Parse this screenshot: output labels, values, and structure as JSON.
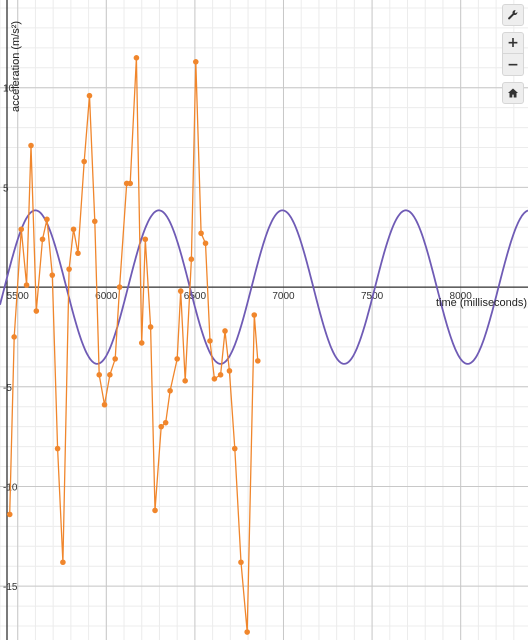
{
  "chart_data": {
    "type": "scatter",
    "xlabel": "time (milliseconds)",
    "ylabel": "acceleration (m/s²)",
    "xlim": [
      5400,
      8380
    ],
    "ylim": [
      -17.7,
      14.4
    ],
    "x_ticks": [
      5500,
      6000,
      6500,
      7000,
      7500,
      8000
    ],
    "x_tick_labels": [
      "5500",
      "6000",
      "6500",
      "7000",
      "7500",
      "8000"
    ],
    "y_ticks": [
      10,
      5,
      -5,
      -10,
      -15
    ],
    "y_tick_labels": [
      "10",
      "5",
      "-5",
      "-10",
      "-15"
    ],
    "minor_grid_step_x": 100,
    "minor_grid_step_y": 1,
    "major_grid_step_x": 500,
    "major_grid_step_y": 5,
    "grid": true,
    "series": [
      {
        "kind": "points-line",
        "color": "#f0862c",
        "points": [
          [
            5455,
            -11.4
          ],
          [
            5480,
            -2.5
          ],
          [
            5520,
            2.9
          ],
          [
            5550,
            0.1
          ],
          [
            5575,
            7.1
          ],
          [
            5605,
            -1.2
          ],
          [
            5640,
            2.4
          ],
          [
            5665,
            3.4
          ],
          [
            5695,
            0.6
          ],
          [
            5725,
            -8.1
          ],
          [
            5755,
            -13.8
          ],
          [
            5790,
            0.9
          ],
          [
            5815,
            2.9
          ],
          [
            5840,
            1.7
          ],
          [
            5875,
            6.3
          ],
          [
            5905,
            9.6
          ],
          [
            5935,
            3.3
          ],
          [
            5960,
            -4.4
          ],
          [
            5990,
            -5.9
          ],
          [
            6020,
            -4.4
          ],
          [
            6050,
            -3.6
          ],
          [
            6075,
            0.0
          ],
          [
            6115,
            5.2
          ],
          [
            6135,
            5.2
          ],
          [
            6170,
            11.5
          ],
          [
            6200,
            -2.8
          ],
          [
            6220,
            2.4
          ],
          [
            6250,
            -2.0
          ],
          [
            6275,
            -11.2
          ],
          [
            6310,
            -7.0
          ],
          [
            6335,
            -6.8
          ],
          [
            6360,
            -5.2
          ],
          [
            6400,
            -3.6
          ],
          [
            6420,
            -0.2
          ],
          [
            6445,
            -4.7
          ],
          [
            6480,
            1.4
          ],
          [
            6505,
            11.3
          ],
          [
            6535,
            2.7
          ],
          [
            6560,
            2.2
          ],
          [
            6585,
            -2.7
          ],
          [
            6610,
            -4.6
          ],
          [
            6645,
            -4.4
          ],
          [
            6670,
            -2.2
          ],
          [
            6695,
            -4.2
          ],
          [
            6725,
            -8.1
          ],
          [
            6760,
            -13.8
          ],
          [
            6795,
            -17.3
          ],
          [
            6835,
            -1.4
          ],
          [
            6855,
            -3.7
          ]
        ]
      },
      {
        "kind": "sine",
        "color": "#6f5bb5",
        "amplitude": 3.85,
        "period": 697,
        "x_peak": 5600
      }
    ]
  },
  "toolbar": {
    "wrench_icon": "wrench-icon",
    "zoom_in_label": "+",
    "zoom_out_label": "−",
    "home_icon": "home-icon"
  }
}
